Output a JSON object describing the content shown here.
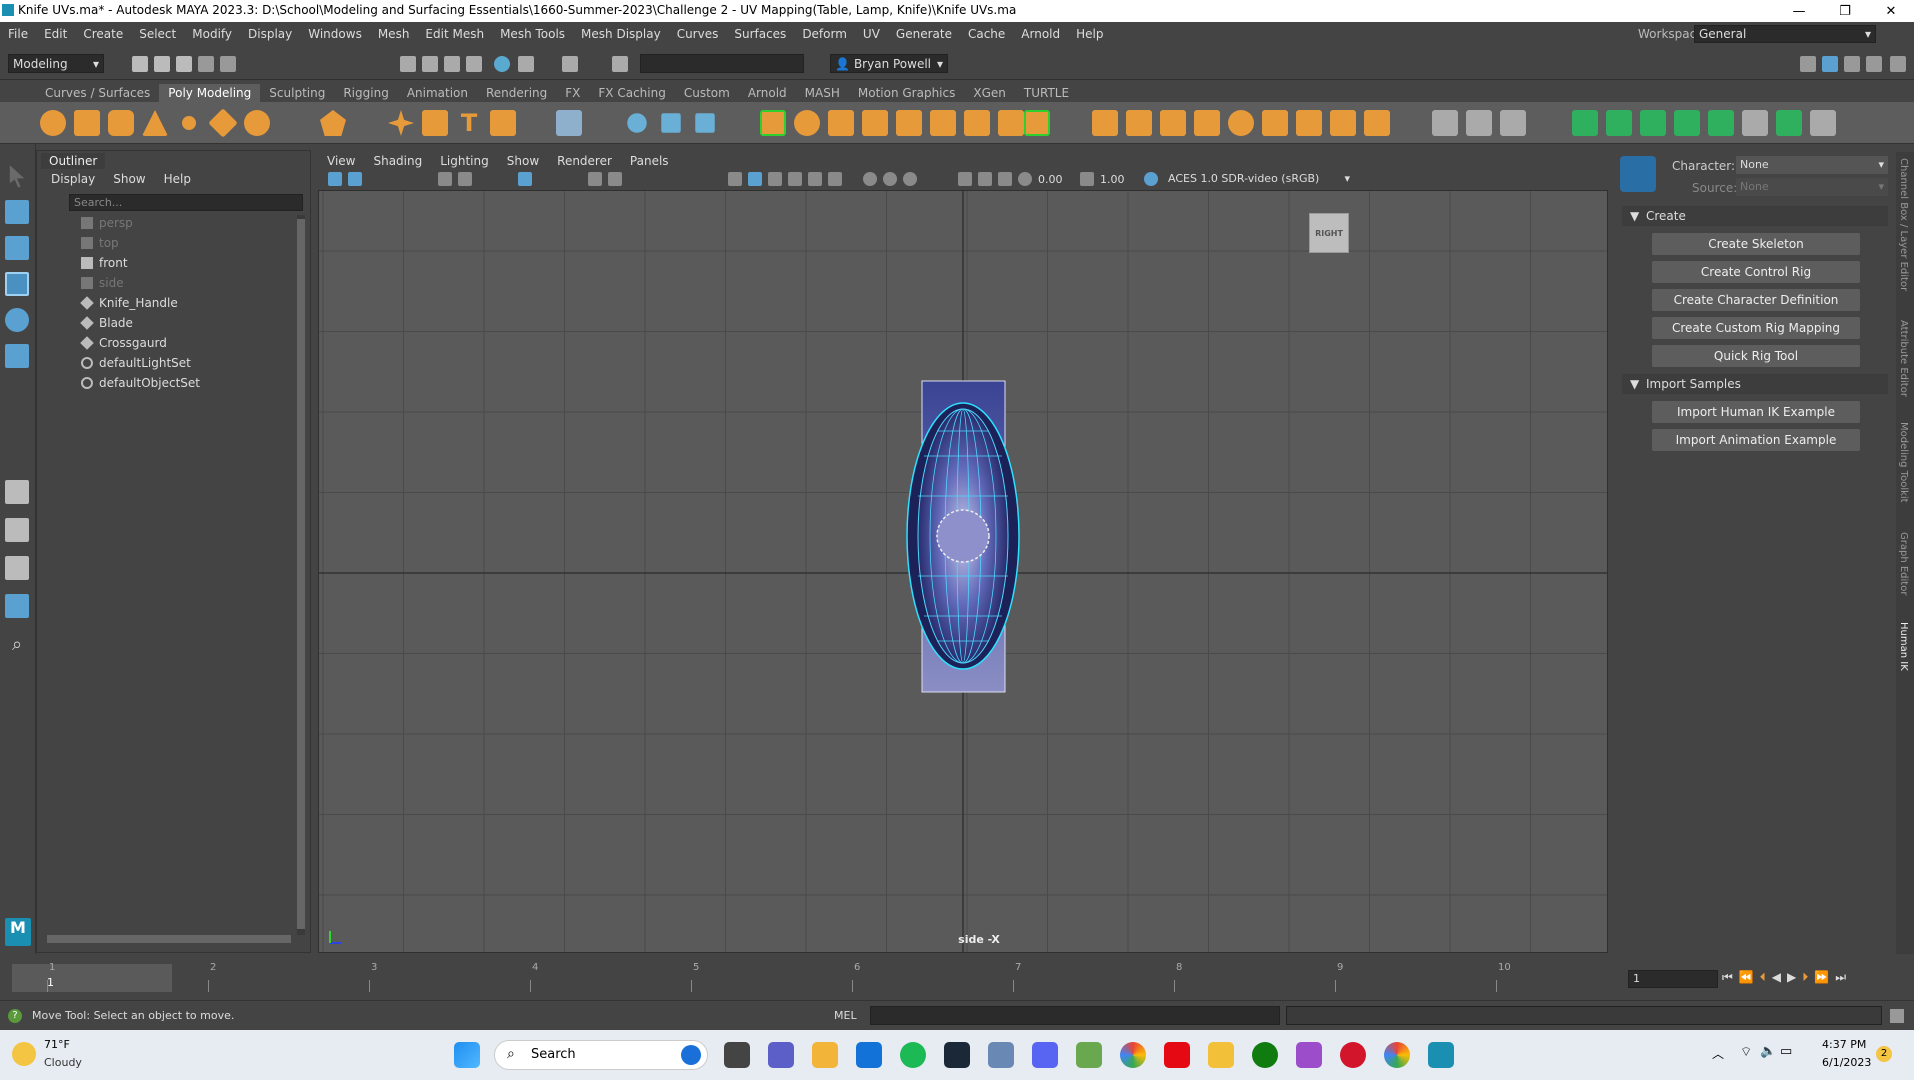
{
  "window": {
    "title": "Knife UVs.ma* - Autodesk MAYA 2023.3: D:\\School\\Modeling and Surfacing Essentials\\1660-Summer-2023\\Challenge 2 - UV Mapping(Table, Lamp, Knife)\\Knife UVs.ma",
    "minimize": "—",
    "maximize": "❐",
    "close": "✕"
  },
  "menubar": {
    "items": [
      "File",
      "Edit",
      "Create",
      "Select",
      "Modify",
      "Display",
      "Windows",
      "Mesh",
      "Edit Mesh",
      "Mesh Tools",
      "Mesh Display",
      "Curves",
      "Surfaces",
      "Deform",
      "UV",
      "Generate",
      "Cache",
      "Arnold",
      "Help"
    ],
    "workspace_label": "Workspace:",
    "workspace_value": "General"
  },
  "statusline": {
    "mode": "Modeling",
    "user": "Bryan Powell"
  },
  "shelf": {
    "tabs": [
      "Curves / Surfaces",
      "Poly Modeling",
      "Sculpting",
      "Rigging",
      "Animation",
      "Rendering",
      "FX",
      "FX Caching",
      "Custom",
      "Arnold",
      "MASH",
      "Motion Graphics",
      "XGen",
      "TURTLE"
    ],
    "active": "Poly Modeling"
  },
  "outliner": {
    "title": "Outliner",
    "menu": [
      "Display",
      "Show",
      "Help"
    ],
    "search_placeholder": "Search...",
    "items": [
      {
        "label": "persp",
        "icon": "camera-icon",
        "dim": true
      },
      {
        "label": "top",
        "icon": "camera-icon",
        "dim": true
      },
      {
        "label": "front",
        "icon": "camera-icon",
        "dim": false
      },
      {
        "label": "side",
        "icon": "camera-icon",
        "dim": true
      },
      {
        "label": "Knife_Handle",
        "icon": "transform-icon",
        "dim": false
      },
      {
        "label": "Blade",
        "icon": "transform-icon",
        "dim": false
      },
      {
        "label": "Crossgaurd",
        "icon": "transform-icon",
        "dim": false
      },
      {
        "label": "defaultLightSet",
        "icon": "set-icon",
        "dim": false
      },
      {
        "label": "defaultObjectSet",
        "icon": "set-icon",
        "dim": false
      }
    ]
  },
  "panel": {
    "menu": [
      "View",
      "Shading",
      "Lighting",
      "Show",
      "Renderer",
      "Panels"
    ],
    "exposure": "0.00",
    "gamma": "1.00",
    "colorspace": "ACES 1.0 SDR-video (sRGB)",
    "camera_label": "side -X",
    "viewcube": "RIGHT"
  },
  "humanik": {
    "character_label": "Character:",
    "character_value": "None",
    "source_label": "Source:",
    "source_value": "None",
    "create_section": "Create",
    "create_buttons": [
      "Create Skeleton",
      "Create Control Rig",
      "Create Character Definition",
      "Create Custom Rig Mapping",
      "Quick Rig Tool"
    ],
    "import_section": "Import Samples",
    "import_buttons": [
      "Import Human IK Example",
      "Import Animation Example"
    ]
  },
  "sidetabs": [
    "Channel Box / Layer Editor",
    "Attribute Editor",
    "Modeling Toolkit",
    "Graph Editor",
    "Human IK"
  ],
  "timeline": {
    "ticks": [
      "1",
      "2",
      "3",
      "4",
      "5",
      "6",
      "7",
      "8",
      "9",
      "10"
    ],
    "current": "1",
    "current_field": "1"
  },
  "commandline": {
    "help": "Move Tool: Select an object to move.",
    "lang": "MEL"
  },
  "taskbar": {
    "weather_temp": "71°F",
    "weather_cond": "Cloudy",
    "search_label": "Search",
    "time": "4:37 PM",
    "date": "6/1/2023",
    "notif_count": "2"
  }
}
